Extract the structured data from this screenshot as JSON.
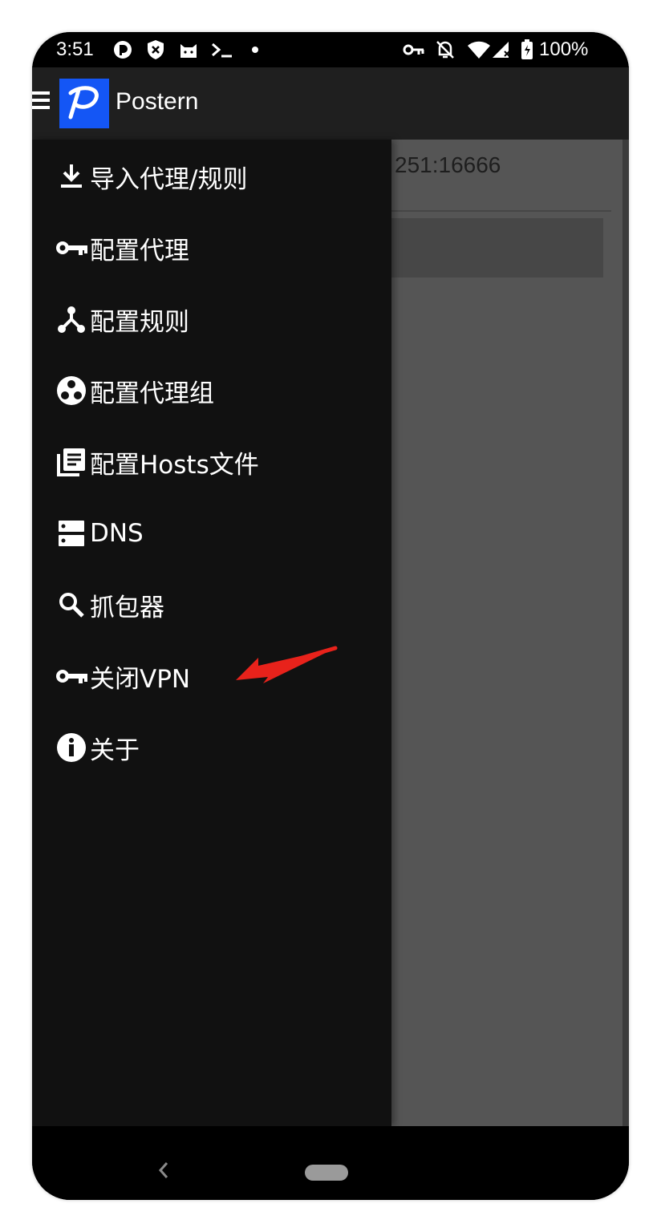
{
  "status_bar": {
    "time": "3:51",
    "battery": "100%"
  },
  "app_bar": {
    "title": "Postern",
    "logo_color": "#1456f5"
  },
  "background_content": {
    "proxy_text": "251:16666"
  },
  "drawer": {
    "items": [
      {
        "label": "导入代理/规则",
        "icon": "download-icon"
      },
      {
        "label": "配置代理",
        "icon": "key-icon"
      },
      {
        "label": "配置规则",
        "icon": "branch-icon"
      },
      {
        "label": "配置代理组",
        "icon": "group-icon"
      },
      {
        "label": "配置Hosts文件",
        "icon": "library-icon"
      },
      {
        "label": "DNS",
        "icon": "dns-server-icon"
      },
      {
        "label": "抓包器",
        "icon": "search-icon"
      },
      {
        "label": "关闭VPN",
        "icon": "vpn-key-icon"
      },
      {
        "label": "关于",
        "icon": "info-icon"
      }
    ]
  },
  "annotation": {
    "arrow_color": "#e8221b",
    "points_to": "关闭VPN"
  },
  "colors": {
    "drawer_bg": "#111111",
    "appbar_bg": "#1f1f1f",
    "scrim": "#555555"
  }
}
